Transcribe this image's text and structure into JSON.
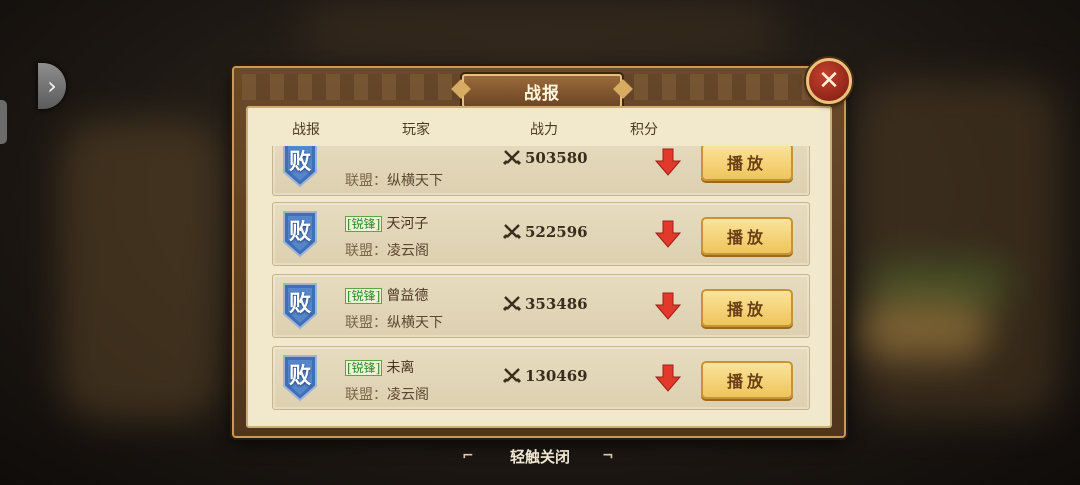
{
  "dialog": {
    "title": "战报",
    "headers": {
      "battle": "战报",
      "player": "玩家",
      "power": "战力",
      "score": "积分"
    },
    "alliance_label": "联盟：",
    "rows": [
      {
        "result": "败",
        "rank": "",
        "name": "",
        "alliance": "纵横天下",
        "power": "503580",
        "score_trend": "down",
        "play_label": "播放"
      },
      {
        "result": "败",
        "rank": "[锐锋]",
        "name": "天河子",
        "alliance": "凌云阁",
        "power": "522596",
        "score_trend": "down",
        "play_label": "播放"
      },
      {
        "result": "败",
        "rank": "[锐锋]",
        "name": "曾益德",
        "alliance": "纵横天下",
        "power": "353486",
        "score_trend": "down",
        "play_label": "播放"
      },
      {
        "result": "败",
        "rank": "[锐锋]",
        "name": "未离",
        "alliance": "凌云阁",
        "power": "130469",
        "score_trend": "down",
        "play_label": "播放"
      }
    ]
  },
  "footer": {
    "close_hint": "轻触关闭"
  },
  "icons": {
    "close": "close-icon",
    "power": "crossed-swords-icon",
    "trend": "red-down-arrow-icon",
    "result": "defeat-shield-icon",
    "nav": "chevron-right-icon"
  },
  "colors": {
    "arrow": "#e23a2a",
    "button": "#f3cf6f",
    "tag": "#2f8a2a",
    "shield": "#3f6fb7"
  }
}
